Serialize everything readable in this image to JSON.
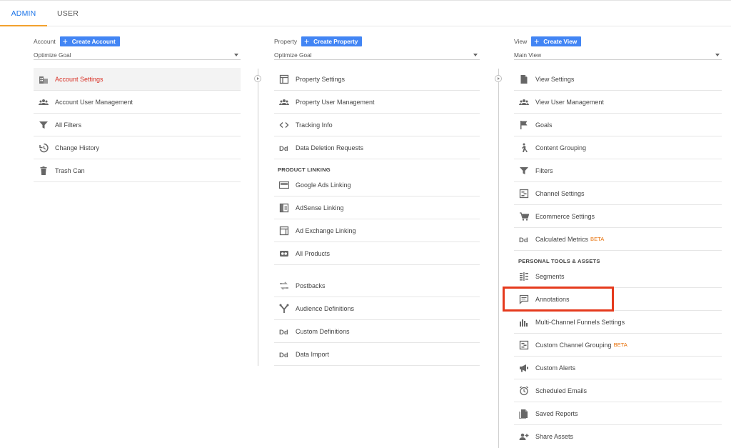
{
  "tabs": {
    "admin": "ADMIN",
    "user": "USER"
  },
  "account": {
    "label": "Account",
    "create_label": "Create Account",
    "selected": "Optimize Goal",
    "items": [
      {
        "label": "Account Settings",
        "icon": "building-icon"
      },
      {
        "label": "Account User Management",
        "icon": "users-icon"
      },
      {
        "label": "All Filters",
        "icon": "filter-icon"
      },
      {
        "label": "Change History",
        "icon": "history-icon"
      },
      {
        "label": "Trash Can",
        "icon": "trash-icon"
      }
    ]
  },
  "property": {
    "label": "Property",
    "create_label": "Create Property",
    "selected": "Optimize Goal",
    "items": [
      {
        "label": "Property Settings",
        "icon": "window-icon"
      },
      {
        "label": "Property User Management",
        "icon": "users-icon"
      },
      {
        "label": "Tracking Info",
        "icon": "code-icon"
      },
      {
        "label": "Data Deletion Requests",
        "icon": "dd-icon"
      }
    ],
    "product_linking_title": "PRODUCT LINKING",
    "linking_items": [
      {
        "label": "Google Ads Linking",
        "icon": "ads-icon"
      },
      {
        "label": "AdSense Linking",
        "icon": "adsense-icon"
      },
      {
        "label": "Ad Exchange Linking",
        "icon": "ad-exchange-icon"
      },
      {
        "label": "All Products",
        "icon": "all-products-icon"
      }
    ],
    "other_items": [
      {
        "label": "Postbacks",
        "icon": "postbacks-icon"
      },
      {
        "label": "Audience Definitions",
        "icon": "audience-icon"
      },
      {
        "label": "Custom Definitions",
        "icon": "dd-icon"
      },
      {
        "label": "Data Import",
        "icon": "dd-icon"
      }
    ]
  },
  "view": {
    "label": "View",
    "create_label": "Create View",
    "selected": "Main View",
    "items": [
      {
        "label": "View Settings",
        "icon": "document-icon"
      },
      {
        "label": "View User Management",
        "icon": "users-icon"
      },
      {
        "label": "Goals",
        "icon": "flag-icon"
      },
      {
        "label": "Content Grouping",
        "icon": "person-walk-icon"
      },
      {
        "label": "Filters",
        "icon": "filter-icon"
      },
      {
        "label": "Channel Settings",
        "icon": "channel-icon"
      },
      {
        "label": "Ecommerce Settings",
        "icon": "cart-icon"
      },
      {
        "label": "Calculated Metrics",
        "icon": "dd-icon",
        "beta": "BETA"
      }
    ],
    "personal_title": "PERSONAL TOOLS & ASSETS",
    "personal_items": [
      {
        "label": "Segments",
        "icon": "segments-icon"
      },
      {
        "label": "Annotations",
        "icon": "comment-icon"
      },
      {
        "label": "Multi-Channel Funnels Settings",
        "icon": "bar-chart-icon"
      },
      {
        "label": "Custom Channel Grouping",
        "icon": "channel-icon",
        "beta": "BETA"
      },
      {
        "label": "Custom Alerts",
        "icon": "megaphone-icon"
      },
      {
        "label": "Scheduled Emails",
        "icon": "clock-icon"
      },
      {
        "label": "Saved Reports",
        "icon": "saved-report-icon"
      },
      {
        "label": "Share Assets",
        "icon": "share-user-icon"
      }
    ]
  },
  "colors": {
    "accent": "#4285f4",
    "active_text": "#d93025",
    "tab_underline": "#f2a12e",
    "highlight": "#e53a1d",
    "beta": "#e8710a"
  }
}
